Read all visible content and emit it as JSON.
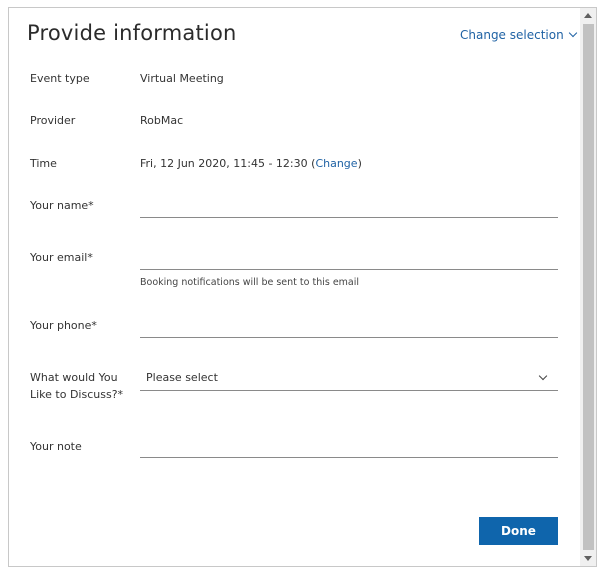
{
  "header": {
    "title": "Provide information",
    "change_selection": "Change selection"
  },
  "details": {
    "event_type_label": "Event type",
    "event_type_value": "Virtual Meeting",
    "provider_label": "Provider",
    "provider_value": "RobMac",
    "time_label": "Time",
    "time_value": "Fri, 12 Jun 2020, 11:45 - 12:30",
    "time_open_paren": "(",
    "time_change_link": "Change",
    "time_close_paren": ")"
  },
  "form": {
    "name_label": "Your name*",
    "name_value": "",
    "email_label": "Your email*",
    "email_value": "",
    "email_helper": "Booking notifications will be sent to this email",
    "phone_label": "Your phone*",
    "phone_value": "",
    "discuss_label_line1": "What would You",
    "discuss_label_line2": "Like to Discuss?*",
    "discuss_selected": "Please select",
    "note_label": "Your note",
    "note_value": ""
  },
  "actions": {
    "done_label": "Done"
  },
  "colors": {
    "accent": "#1f62a4",
    "button": "#0f65ac"
  }
}
